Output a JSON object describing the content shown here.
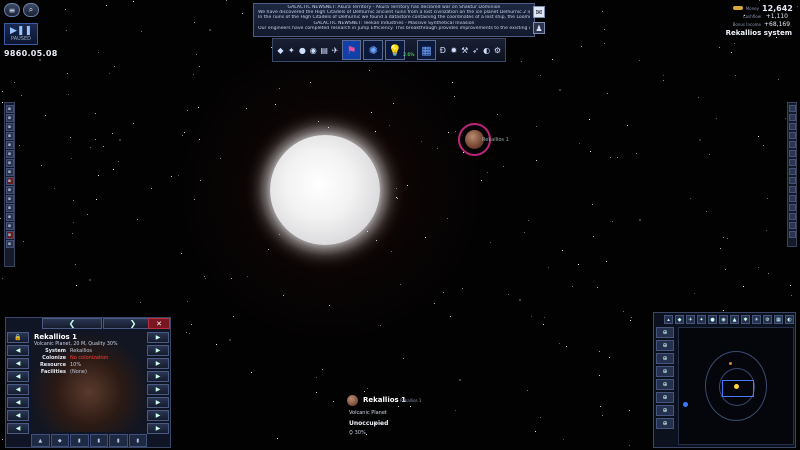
{
  "top_left": {
    "speed_label": "PAUSED",
    "date": "9860.05.08"
  },
  "news": {
    "lines": [
      "GALACTIC NEWSNET: Akura Territory - Akura Territory has declared war on Shaktur Dominion",
      "We have discovered the High Citadels of Delhurnic ancient ruins from a lost civilization on the ice planet Delhurnic 2 in the Delhurnic sy",
      "In the ruins of the High Citadels of Delhurnic we found a datastore containing the coordinates of a lost ship, the Looming Plague. The shi",
      "GALACTIC NEWSNET: Teekan Industries - Massive Synthetical Invasion",
      "Our engineers have completed research in Jump Efficiency. This breakthrough provides improvements to the existing component"
    ]
  },
  "toolbar": {
    "percent": "2.6%"
  },
  "resources": {
    "money_label": "Money",
    "money": "12,642",
    "cashflow_label": "Cashflow",
    "cashflow": "+1,110",
    "bonus_label": "Bonus Income",
    "bonus": "+68,169"
  },
  "system_name": "Rekallios system",
  "planet_marker_label": "Rekallios 1",
  "info_panel": {
    "title": "Rekallios 1",
    "subtitle": "Volcanic Planet, 20 M,  Quality 30%",
    "rows": [
      {
        "k": "System",
        "v": "Rekallios",
        "red": false
      },
      {
        "k": "Colonize",
        "v": "No colonization",
        "red": true
      },
      {
        "k": "Resource",
        "v": "10%",
        "red": false
      },
      {
        "k": "Facilities",
        "v": "(None)",
        "red": false
      }
    ]
  },
  "planet_label": {
    "name": "Rekallios 1",
    "tag": "Rekallios 1",
    "type": "Volcanic Planet",
    "status": "Unoccupied",
    "quality": "30%"
  },
  "colors": {
    "selection_ring": "#c0247a",
    "panel_border": "#3b4767",
    "accent_blue": "#1040a8"
  }
}
